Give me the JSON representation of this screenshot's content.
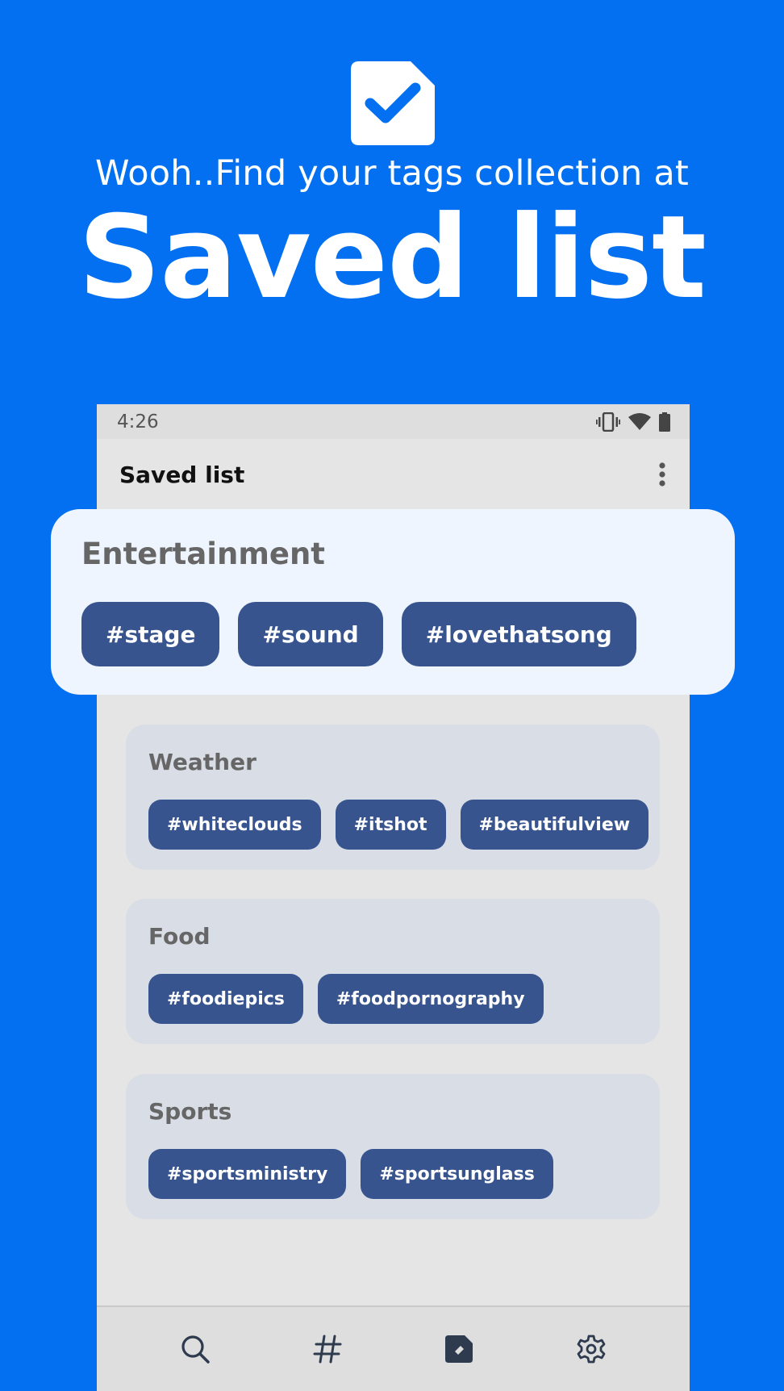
{
  "hero": {
    "icon": "checked-document-icon",
    "subtitle": "Wooh..Find your tags collection at",
    "title": "Saved list"
  },
  "status_bar": {
    "time": "4:26",
    "icons": [
      "vibrate-icon",
      "wifi-icon",
      "battery-icon"
    ]
  },
  "app_bar": {
    "title": "Saved list",
    "menu_icon": "more-vert-icon"
  },
  "featured": {
    "title": "Entertainment",
    "tags": [
      "#stage",
      "#sound",
      "#lovethatsong"
    ]
  },
  "collections": [
    {
      "title": "Weather",
      "tags": [
        "#whiteclouds",
        "#itshot",
        "#beautifulview"
      ]
    },
    {
      "title": "Food",
      "tags": [
        "#foodiepics",
        "#foodpornography"
      ]
    },
    {
      "title": "Sports",
      "tags": [
        "#sportsministry",
        "#sportsunglass"
      ]
    }
  ],
  "bottom_nav": {
    "items": [
      "search-icon",
      "hashtag-icon",
      "saved-tag-icon",
      "settings-icon"
    ]
  },
  "colors": {
    "background": "#0270F0",
    "chip": "#37548F",
    "card": "#D8DDE6",
    "popout": "#EEF5FF"
  }
}
